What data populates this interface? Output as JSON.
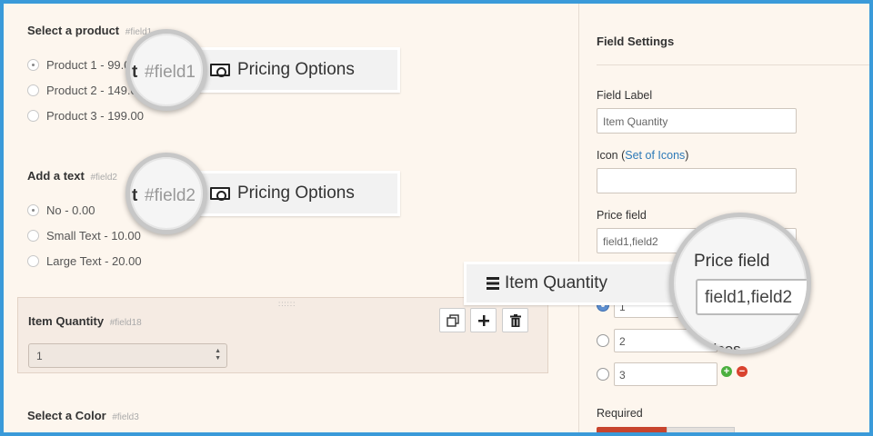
{
  "form": {
    "field1": {
      "title": "Select a product",
      "id": "#field1",
      "options": [
        "Product 1 - 99.0",
        "Product 2 - 149.0",
        "Product 3 - 199.00"
      ]
    },
    "field2": {
      "title": "Add a text",
      "id": "#field2",
      "options": [
        "No - 0.00",
        "Small Text - 10.00",
        "Large Text - 20.00"
      ]
    },
    "selected": {
      "title": "Item Quantity",
      "id": "#field18",
      "value": "1",
      "drag_handle": "::::::"
    },
    "field3": {
      "title": "Select a Color",
      "id": "#field3"
    }
  },
  "toolbar": {
    "copy_icon": "copy-icon",
    "add_icon": "plus-icon",
    "delete_icon": "trash-icon"
  },
  "settings": {
    "title": "Field Settings",
    "label_label": "Field Label",
    "label_value": "Item Quantity",
    "icon_label_prefix": "Icon (",
    "icon_link": "Set of Icons",
    "icon_label_suffix": ")",
    "price_label": "Price field",
    "price_value": "field1,field2",
    "choices": [
      "1",
      "2",
      "3"
    ],
    "choices_fragment": "oices",
    "required_label": "Required"
  },
  "callouts": {
    "c1_lens": "#field1",
    "c1_prefix": "t",
    "c1_text": "Pricing Options",
    "c2_lens": "#field2",
    "c2_prefix": "t",
    "c2_text": "Pricing Options",
    "c3_text": "Item Quantity",
    "c3_list_digits": "1\n2\n3",
    "c4_label": "Price field",
    "c4_value": "field1,field2"
  },
  "colors": {
    "frame": "#3a9ad9",
    "link": "#2d7ab8",
    "required_on": "#c8452e",
    "add": "#4caf3f",
    "remove": "#d9432f"
  }
}
